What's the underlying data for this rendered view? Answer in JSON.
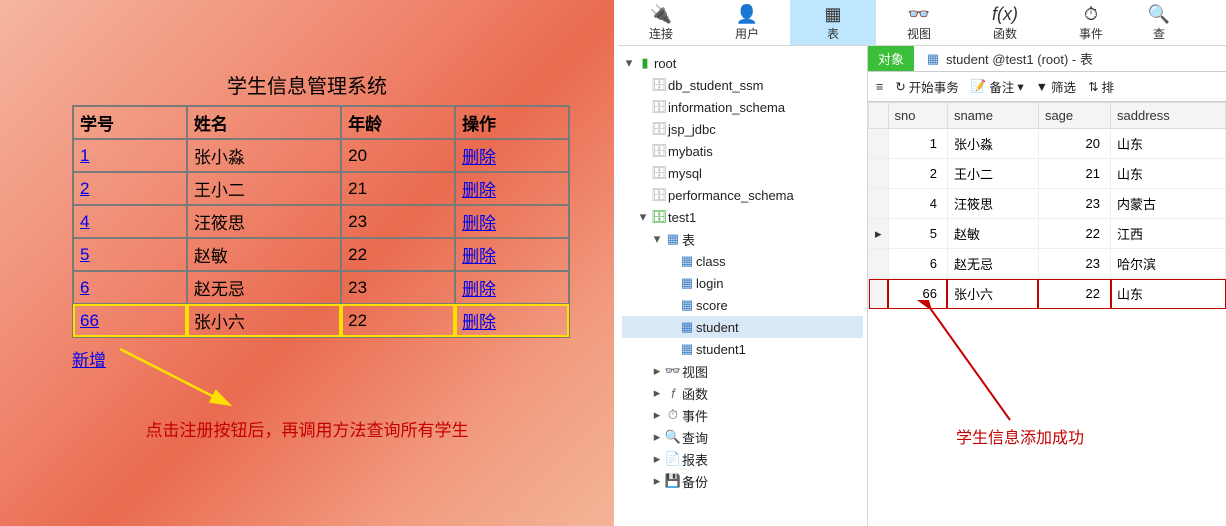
{
  "left": {
    "title": "学生信息管理系统",
    "headers": [
      "学号",
      "姓名",
      "年龄",
      "操作"
    ],
    "rows": [
      {
        "id": "1",
        "name": "张小淼",
        "age": "20",
        "action": "删除"
      },
      {
        "id": "2",
        "name": "王小二",
        "age": "21",
        "action": "删除"
      },
      {
        "id": "4",
        "name": "汪筱思",
        "age": "23",
        "action": "删除"
      },
      {
        "id": "5",
        "name": "赵敏",
        "age": "22",
        "action": "删除"
      },
      {
        "id": "6",
        "name": "赵无忌",
        "age": "23",
        "action": "删除"
      },
      {
        "id": "66",
        "name": "张小六",
        "age": "22",
        "action": "删除"
      }
    ],
    "add_link": "新增",
    "caption": "点击注册按钮后，再调用方法查询所有学生"
  },
  "toolbar": {
    "conn": "连接",
    "user": "用户",
    "table": "表",
    "view": "视图",
    "func": "函数",
    "event": "事件",
    "query": "查"
  },
  "tree": {
    "root": "root",
    "dbs": [
      "db_student_ssm",
      "information_schema",
      "jsp_jdbc",
      "mybatis",
      "mysql",
      "performance_schema"
    ],
    "open_db": "test1",
    "tables_label": "表",
    "tables": [
      "class",
      "login",
      "score",
      "student",
      "student1"
    ],
    "folders": {
      "view": "视图",
      "func": "函数",
      "event": "事件",
      "query": "查询",
      "report": "报表",
      "backup": "备份"
    }
  },
  "tabs": {
    "objects": "对象",
    "file": "student @test1 (root) - 表"
  },
  "grid_toolbar": {
    "menu": "≡",
    "begin_tx": "开始事务",
    "remark": "备注",
    "filter": "筛选",
    "sort": "排"
  },
  "grid": {
    "headers": [
      "sno",
      "sname",
      "sage",
      "saddress"
    ],
    "rows": [
      {
        "sno": "1",
        "sname": "张小淼",
        "sage": "20",
        "saddress": "山东"
      },
      {
        "sno": "2",
        "sname": "王小二",
        "sage": "21",
        "saddress": "山东"
      },
      {
        "sno": "4",
        "sname": "汪筱思",
        "sage": "23",
        "saddress": "内蒙古"
      },
      {
        "sno": "5",
        "sname": "赵敏",
        "sage": "22",
        "saddress": "江西"
      },
      {
        "sno": "6",
        "sname": "赵无忌",
        "sage": "23",
        "saddress": "哈尔滨"
      },
      {
        "sno": "66",
        "sname": "张小六",
        "sage": "22",
        "saddress": "山东"
      }
    ],
    "current_row_index": 3
  },
  "annotation": "学生信息添加成功",
  "chart_data": {
    "type": "table",
    "title": "student @test1",
    "columns": [
      "sno",
      "sname",
      "sage",
      "saddress"
    ],
    "rows": [
      [
        1,
        "张小淼",
        20,
        "山东"
      ],
      [
        2,
        "王小二",
        21,
        "山东"
      ],
      [
        4,
        "汪筱思",
        23,
        "内蒙古"
      ],
      [
        5,
        "赵敏",
        22,
        "江西"
      ],
      [
        6,
        "赵无忌",
        23,
        "哈尔滨"
      ],
      [
        66,
        "张小六",
        22,
        "山东"
      ]
    ]
  }
}
